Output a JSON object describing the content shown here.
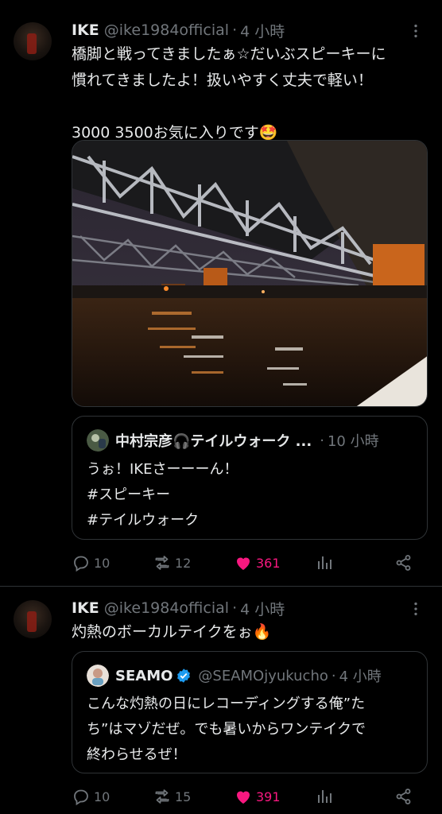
{
  "tweets": [
    {
      "name": "IKE",
      "handle": "@ike1984official",
      "dot": "·",
      "time": "4 小時",
      "text": "橋脚と戦ってきましたぁ☆だいぶスピーキーに\n慣れてきましたよ！扱いやすく丈夫で軽い！\n\n3000 3500お気に入りです🤩",
      "quote": {
        "name": "中村宗彦🎧テイルウォーク ...",
        "dot": "·",
        "time": "10 小時",
        "text": "うぉ！IKEさーーーん！\n#スピーキー\n#テイルウォーク"
      },
      "actions": {
        "replies": "10",
        "retweets": "12",
        "likes": "361"
      }
    },
    {
      "name": "IKE",
      "handle": "@ike1984official",
      "dot": "·",
      "time": "4 小時",
      "text": "灼熱のボーカルテイクをぉ🔥",
      "quote": {
        "name": "SEAMO",
        "handle": "@SEAMOjyukucho",
        "dot": "·",
        "time": "4 小時",
        "text": "こんな灼熱の日にレコーディングする俺”た\nち”はマゾだぜ。でも暑いからワンテイクで\n終わらせるぜ！"
      },
      "actions": {
        "replies": "10",
        "retweets": "15",
        "likes": "391"
      }
    }
  ],
  "icons": {
    "reply": "reply-icon",
    "retweet": "retweet-icon",
    "like": "heart-icon",
    "views": "analytics-icon",
    "share": "share-icon",
    "more": "more-icon",
    "verified": "verified-badge-icon"
  },
  "colors": {
    "background": "#000000",
    "text": "#e7e9ea",
    "muted": "#71767b",
    "like": "#f91880",
    "verified": "#1d9bf0",
    "border": "#2f3336"
  }
}
